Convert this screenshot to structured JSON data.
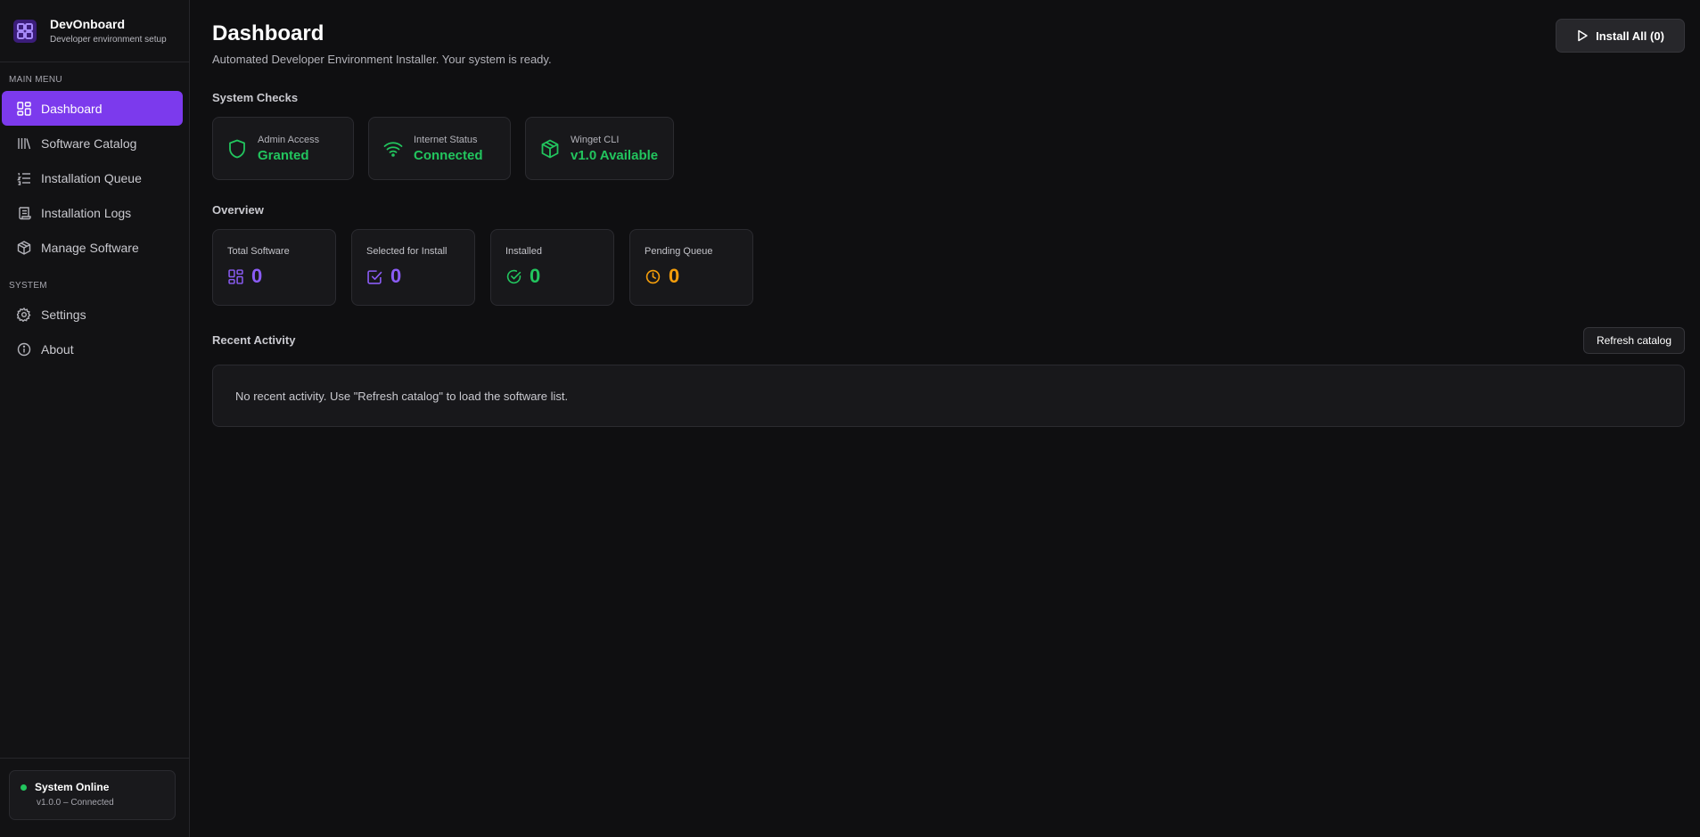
{
  "brand": {
    "title": "DevOnboard",
    "subtitle": "Developer environment setup",
    "logo_icon": "grid-icon",
    "accent": "#7c3aed"
  },
  "sidebar": {
    "main_label": "MAIN MENU",
    "main_items": [
      {
        "label": "Dashboard",
        "icon": "dashboard-icon",
        "active": true
      },
      {
        "label": "Software Catalog",
        "icon": "library-icon",
        "active": false
      },
      {
        "label": "Installation Queue",
        "icon": "list-ordered-icon",
        "active": false
      },
      {
        "label": "Installation Logs",
        "icon": "scroll-icon",
        "active": false
      },
      {
        "label": "Manage Software",
        "icon": "package-icon",
        "active": false
      }
    ],
    "system_label": "SYSTEM",
    "system_items": [
      {
        "label": "Settings",
        "icon": "gear-icon"
      },
      {
        "label": "About",
        "icon": "info-icon"
      }
    ],
    "status": {
      "title": "System Online",
      "subtitle": "v1.0.0 – Connected",
      "color": "#22c55e"
    }
  },
  "header": {
    "title": "Dashboard",
    "subtitle": "Automated Developer Environment Installer. Your system is ready.",
    "install_button": "Install All (0)"
  },
  "system_checks": {
    "title": "System Checks",
    "items": [
      {
        "label": "Admin Access",
        "value": "Granted",
        "icon": "shield-icon"
      },
      {
        "label": "Internet Status",
        "value": "Connected",
        "icon": "wifi-icon"
      },
      {
        "label": "Winget CLI",
        "value": "v1.0 Available",
        "icon": "box-icon"
      }
    ],
    "ok_color": "#22c55e"
  },
  "overview": {
    "title": "Overview",
    "stats": [
      {
        "label": "Total Software",
        "value": "0",
        "icon": "dashboard-icon",
        "color": "#8b5cf6"
      },
      {
        "label": "Selected for Install",
        "value": "0",
        "icon": "checkbox-icon",
        "color": "#8b5cf6"
      },
      {
        "label": "Installed",
        "value": "0",
        "icon": "check-circle-icon",
        "color": "#22c55e"
      },
      {
        "label": "Pending Queue",
        "value": "0",
        "icon": "clock-icon",
        "color": "#f59e0b"
      }
    ]
  },
  "recent_activity": {
    "title": "Recent Activity",
    "refresh_button": "Refresh catalog",
    "empty_message": "No recent activity. Use \"Refresh catalog\" to load the software list."
  }
}
